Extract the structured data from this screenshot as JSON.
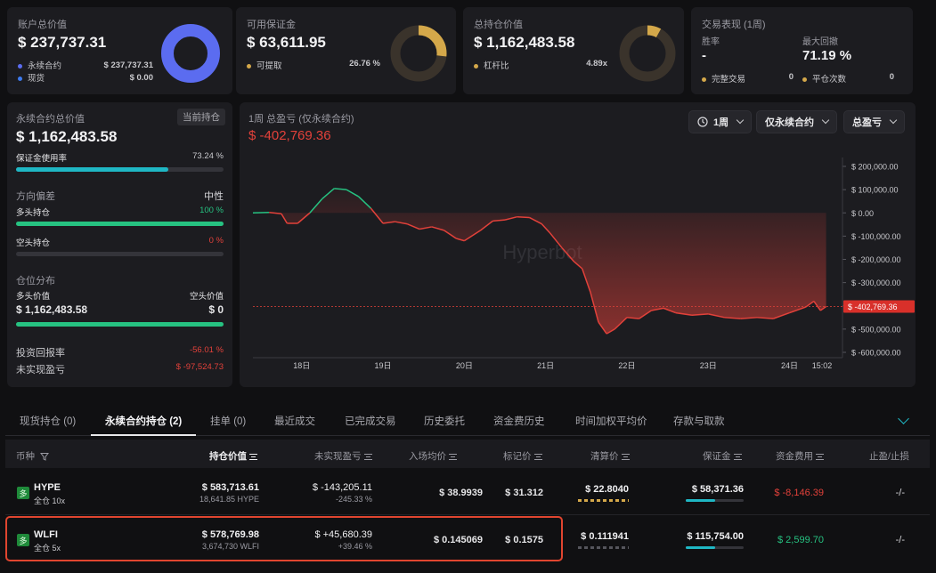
{
  "colors": {
    "accent_blue": "#5b6cf0",
    "gold": "#d4a84a",
    "green": "#26c281",
    "red": "#e2413a",
    "teal": "#1fb7c4",
    "highlight": "#e0452f"
  },
  "account": {
    "label": "账户总价值",
    "value": "$ 237,737.31",
    "rows": [
      {
        "label": "永续合约",
        "value": "$ 237,737.31",
        "color": "#5b6cf0"
      },
      {
        "label": "现货",
        "value": "$ 0.00",
        "color": "#3d7bf0"
      }
    ],
    "donut_fraction": 1.0
  },
  "margin": {
    "label": "可用保证金",
    "value": "$ 63,611.95",
    "sub_label": "可提取",
    "sub_value": "26.76 %",
    "donut_fraction": 0.2676
  },
  "positions": {
    "label": "总持仓价值",
    "value": "$ 1,162,483.58",
    "sub_label": "杠杆比",
    "sub_value": "4.89x",
    "donut_fraction": 0.08
  },
  "performance": {
    "label": "交易表现 (1周)",
    "win_rate_label": "胜率",
    "win_rate_value": "-",
    "drawdown_label": "最大回撤",
    "drawdown_value": "71.19 %",
    "completed_label": "完整交易",
    "completed_value": "0",
    "closes_label": "平仓次数",
    "closes_value": "0"
  },
  "perp_panel": {
    "label": "永续合约总价值",
    "badge": "当前持仓",
    "value": "$ 1,162,483.58",
    "usage_label": "保证金使用率",
    "usage_value": "73.24 %",
    "usage_fraction": 0.7324,
    "bias_label": "方向偏差",
    "bias_value": "中性",
    "long_label": "多头持仓",
    "long_pct": "100 %",
    "long_fraction": 1.0,
    "short_label": "空头持仓",
    "short_pct": "0 %",
    "short_fraction": 0.0,
    "dist_label": "仓位分布",
    "dist_long_label": "多头价值",
    "dist_short_label": "空头价值",
    "dist_long_value": "$ 1,162,483.58",
    "dist_short_value": "$ 0",
    "dist_fraction": 1.0,
    "roi_label": "投资回报率",
    "roi_value": "-56.01 %",
    "upnl_label": "未实现盈亏",
    "upnl_value": "$ -97,524.73"
  },
  "pnl_chart": {
    "title": "1周 总盈亏 (仅永续合约)",
    "value": "$ -402,769.36",
    "controls": {
      "period": "1周",
      "scope": "仅永续合约",
      "metric": "总盈亏"
    },
    "watermark": "Hyperbot",
    "current_label": "$ -402,769.36"
  },
  "chart_data": {
    "type": "area",
    "ylim": [
      -600000,
      200000
    ],
    "y_ticks": [
      200000,
      100000,
      0,
      -100000,
      -200000,
      -300000,
      -400000,
      -500000,
      -600000
    ],
    "y_tick_labels": [
      "$ 200,000.00",
      "$ 100,000.00",
      "$ 0.00",
      "$ -100,000.00",
      "$ -200,000.00",
      "$ -300,000.00",
      "$ -400,000.00",
      "$ -500,000.00",
      "$ -600,000.00"
    ],
    "x_ticks": [
      {
        "t": 0.6,
        "label": "18日"
      },
      {
        "t": 1.6,
        "label": "19日"
      },
      {
        "t": 2.6,
        "label": "20日"
      },
      {
        "t": 3.6,
        "label": "21日"
      },
      {
        "t": 4.6,
        "label": "22日"
      },
      {
        "t": 5.6,
        "label": "23日"
      },
      {
        "t": 6.6,
        "label": "24日"
      },
      {
        "t": 7.0,
        "label": "15:02"
      }
    ],
    "xlim": [
      0,
      7.12
    ],
    "series": [
      {
        "values": [
          [
            0.0,
            0
          ],
          [
            0.2,
            2000
          ],
          [
            0.35,
            -4000
          ],
          [
            0.42,
            -45000
          ],
          [
            0.55,
            -45000
          ],
          [
            0.7,
            0
          ],
          [
            0.85,
            60000
          ],
          [
            1.0,
            105000
          ],
          [
            1.15,
            100000
          ],
          [
            1.3,
            70000
          ],
          [
            1.45,
            20000
          ],
          [
            1.6,
            -45000
          ],
          [
            1.75,
            -38000
          ],
          [
            1.9,
            -48000
          ],
          [
            2.05,
            -70000
          ],
          [
            2.2,
            -60000
          ],
          [
            2.35,
            -75000
          ],
          [
            2.5,
            -110000
          ],
          [
            2.6,
            -120000
          ],
          [
            2.8,
            -75000
          ],
          [
            2.95,
            -35000
          ],
          [
            3.1,
            -30000
          ],
          [
            3.25,
            -17000
          ],
          [
            3.4,
            -20000
          ],
          [
            3.55,
            -47000
          ],
          [
            3.65,
            -85000
          ],
          [
            3.8,
            -150000
          ],
          [
            3.95,
            -210000
          ],
          [
            4.05,
            -240000
          ],
          [
            4.15,
            -340000
          ],
          [
            4.25,
            -470000
          ],
          [
            4.35,
            -520000
          ],
          [
            4.45,
            -500000
          ],
          [
            4.6,
            -450000
          ],
          [
            4.75,
            -455000
          ],
          [
            4.9,
            -420000
          ],
          [
            5.05,
            -410000
          ],
          [
            5.2,
            -430000
          ],
          [
            5.4,
            -440000
          ],
          [
            5.6,
            -435000
          ],
          [
            5.8,
            -450000
          ],
          [
            6.0,
            -455000
          ],
          [
            6.2,
            -450000
          ],
          [
            6.4,
            -455000
          ],
          [
            6.6,
            -430000
          ],
          [
            6.8,
            -405000
          ],
          [
            6.9,
            -380000
          ],
          [
            6.98,
            -420000
          ],
          [
            7.05,
            -402769
          ]
        ]
      }
    ],
    "ref_value": -402769.36
  },
  "tabs": [
    {
      "label": "现货持仓 (0)"
    },
    {
      "label": "永续合约持仓 (2)"
    },
    {
      "label": "挂单 (0)"
    },
    {
      "label": "最近成交"
    },
    {
      "label": "已完成交易"
    },
    {
      "label": "历史委托"
    },
    {
      "label": "资金费历史"
    },
    {
      "label": "时间加权平均价"
    },
    {
      "label": "存款与取款"
    }
  ],
  "table": {
    "headers": {
      "coin": "币种",
      "value": "持仓价值",
      "upnl": "未实现盈亏",
      "entry": "入场均价",
      "mark": "标记价",
      "liq": "清算价",
      "margin": "保证金",
      "funding": "资金费用",
      "tpsl": "止盈/止损"
    },
    "rows": [
      {
        "side": "多",
        "coin": "HYPE",
        "mode": "全仓 10x",
        "value": "$ 583,713.61",
        "size": "18,641.85 HYPE",
        "upnl": "$ -143,205.11",
        "upnl_pct": "-245.33 %",
        "entry": "$ 38.9939",
        "mark": "$ 31.312",
        "liq": "$ 22.8040",
        "margin": "$ 58,371.36",
        "margin_fraction": 0.5,
        "funding": "$ -8,146.39",
        "tpsl": "-/-"
      },
      {
        "side": "多",
        "coin": "WLFI",
        "mode": "全仓 5x",
        "value": "$ 578,769.98",
        "size": "3,674,730 WLFI",
        "upnl": "$ +45,680.39",
        "upnl_pct": "+39.46 %",
        "entry": "$ 0.145069",
        "mark": "$ 0.1575",
        "liq": "$ 0.111941",
        "margin": "$ 115,754.00",
        "margin_fraction": 0.5,
        "funding": "$ 2,599.70",
        "tpsl": "-/-"
      }
    ]
  }
}
